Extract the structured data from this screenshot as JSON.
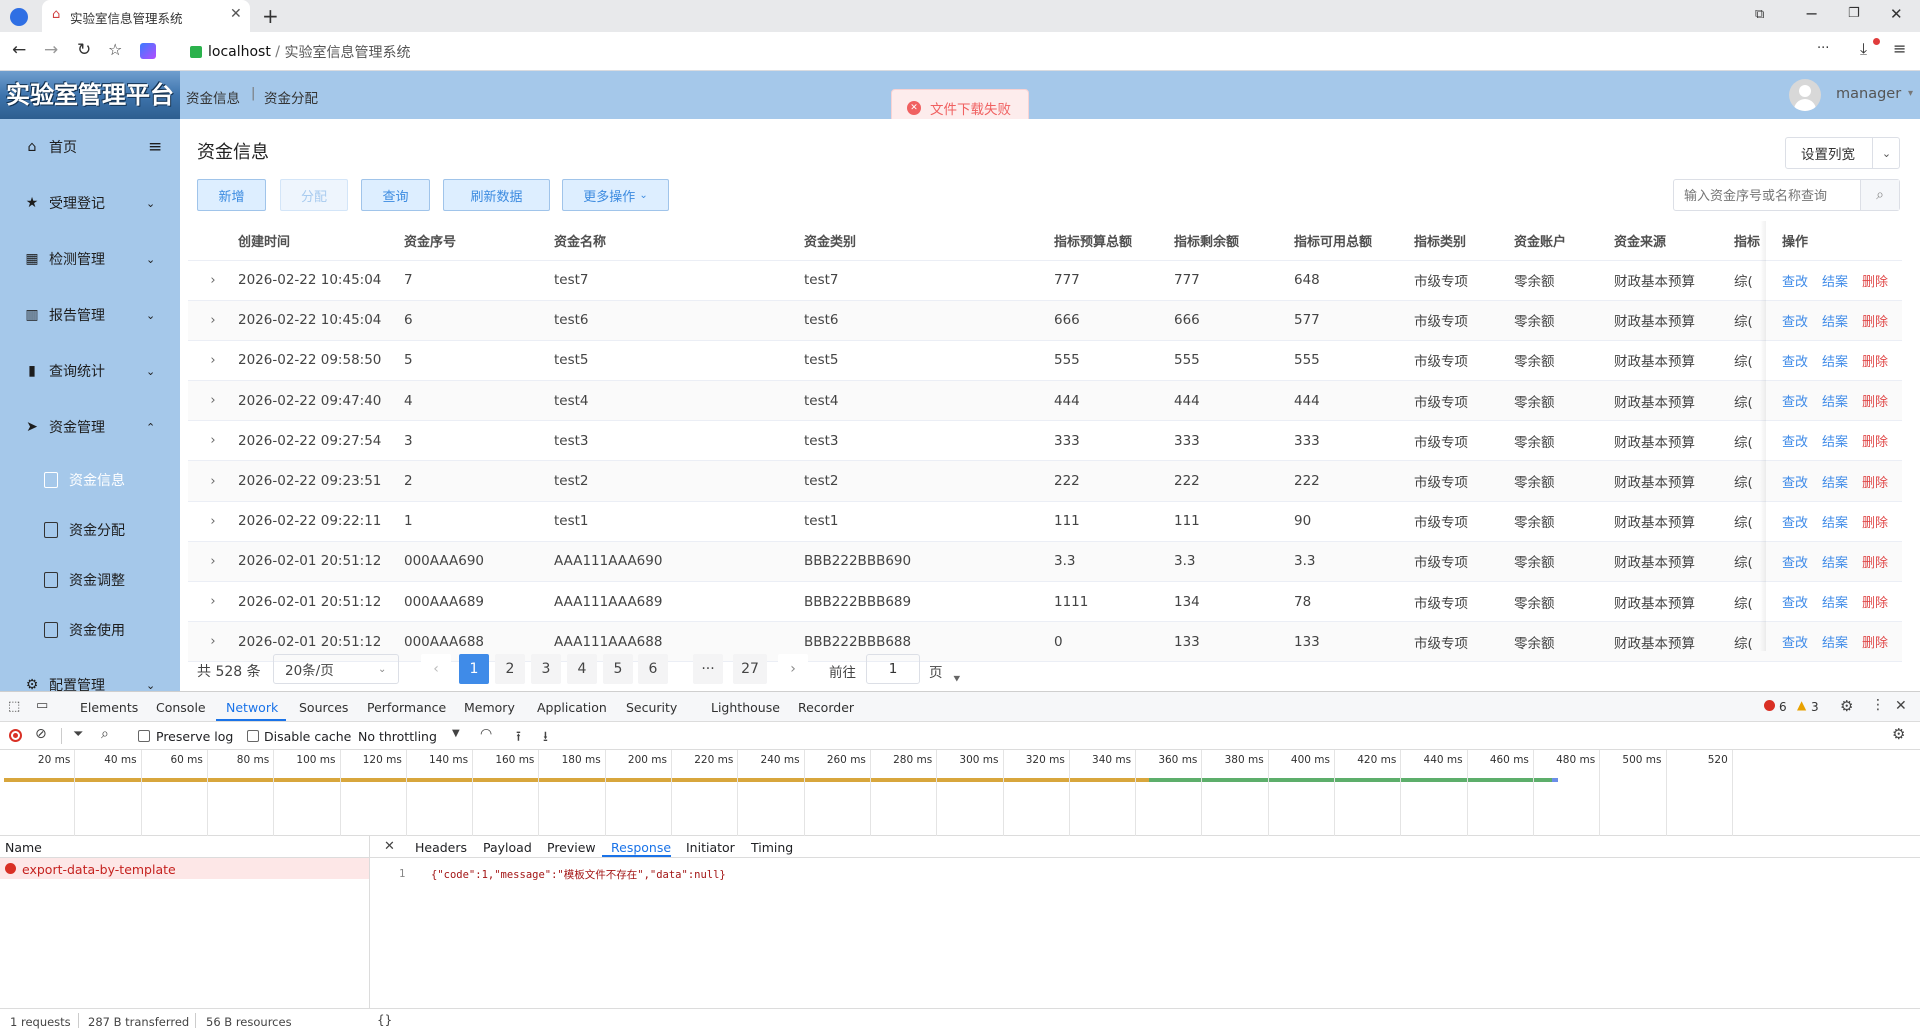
{
  "browser": {
    "tab_title": "实验室信息管理系统",
    "url_host": "localhost",
    "url_sep": " / ",
    "url_title": "实验室信息管理系统",
    "more": "···"
  },
  "header": {
    "logo": "实验室管理平台",
    "breadcrumb1": "资金信息",
    "breadcrumb_sep": "|",
    "breadcrumb2": "资金分配",
    "user": "manager",
    "toast": "文件下载失败"
  },
  "sidebar": {
    "items": [
      {
        "label": "首页"
      },
      {
        "label": "受理登记"
      },
      {
        "label": "检测管理"
      },
      {
        "label": "报告管理"
      },
      {
        "label": "查询统计"
      },
      {
        "label": "资金管理"
      },
      {
        "label": "配置管理"
      }
    ],
    "sub_items": [
      {
        "label": "资金信息"
      },
      {
        "label": "资金分配"
      },
      {
        "label": "资金调整"
      },
      {
        "label": "资金使用"
      }
    ]
  },
  "page": {
    "title": "资金信息",
    "set_width": "设置列宽",
    "buttons": {
      "add": "新增",
      "assign": "分配",
      "query": "查询",
      "refresh": "刷新数据",
      "more": "更多操作"
    },
    "search_placeholder": "输入资金序号或名称查询"
  },
  "table": {
    "headers": [
      "创建时间",
      "资金序号",
      "资金名称",
      "资金类别",
      "指标预算总额",
      "指标剩余额",
      "指标可用总额",
      "指标类别",
      "资金账户",
      "资金来源",
      "指标",
      "操作"
    ],
    "ops": {
      "edit": "查改",
      "close": "结案",
      "delete": "删除"
    },
    "rows": [
      [
        "2026-02-22 10:45:04",
        "7",
        "test7",
        "test7",
        "777",
        "777",
        "648",
        "市级专项",
        "零余额",
        "财政基本预算",
        "综("
      ],
      [
        "2026-02-22 10:45:04",
        "6",
        "test6",
        "test6",
        "666",
        "666",
        "577",
        "市级专项",
        "零余额",
        "财政基本预算",
        "综("
      ],
      [
        "2026-02-22 09:58:50",
        "5",
        "test5",
        "test5",
        "555",
        "555",
        "555",
        "市级专项",
        "零余额",
        "财政基本预算",
        "综("
      ],
      [
        "2026-02-22 09:47:40",
        "4",
        "test4",
        "test4",
        "444",
        "444",
        "444",
        "市级专项",
        "零余额",
        "财政基本预算",
        "综("
      ],
      [
        "2026-02-22 09:27:54",
        "3",
        "test3",
        "test3",
        "333",
        "333",
        "333",
        "市级专项",
        "零余额",
        "财政基本预算",
        "综("
      ],
      [
        "2026-02-22 09:23:51",
        "2",
        "test2",
        "test2",
        "222",
        "222",
        "222",
        "市级专项",
        "零余额",
        "财政基本预算",
        "综("
      ],
      [
        "2026-02-22 09:22:11",
        "1",
        "test1",
        "test1",
        "111",
        "111",
        "90",
        "市级专项",
        "零余额",
        "财政基本预算",
        "综("
      ],
      [
        "2026-02-01 20:51:12",
        "000AAA690",
        "AAA111AAA690",
        "BBB222BBB690",
        "3.3",
        "3.3",
        "3.3",
        "市级专项",
        "零余额",
        "财政基本预算",
        "综("
      ],
      [
        "2026-02-01 20:51:12",
        "000AAA689",
        "AAA111AAA689",
        "BBB222BBB689",
        "1111",
        "134",
        "78",
        "市级专项",
        "零余额",
        "财政基本预算",
        "综("
      ],
      [
        "2026-02-01 20:51:12",
        "000AAA688",
        "AAA111AAA688",
        "BBB222BBB688",
        "0",
        "133",
        "133",
        "市级专项",
        "零余额",
        "财政基本预算",
        "综("
      ]
    ]
  },
  "pagination": {
    "total": "共 528 条",
    "page_size": "20条/页",
    "pages": [
      "1",
      "2",
      "3",
      "4",
      "5",
      "6"
    ],
    "ellipsis": "···",
    "last": "27",
    "goto_label": "前往",
    "goto_value": "1",
    "goto_unit": "页"
  },
  "devtools": {
    "tabs": [
      "Elements",
      "Console",
      "Network",
      "Sources",
      "Performance",
      "Memory",
      "Application",
      "Security",
      "Lighthouse",
      "Recorder"
    ],
    "errors": "6",
    "warnings": "3",
    "preserve_log": "Preserve log",
    "disable_cache": "Disable cache",
    "throttling": "No throttling",
    "ticks": [
      "20 ms",
      "40 ms",
      "60 ms",
      "80 ms",
      "100 ms",
      "120 ms",
      "140 ms",
      "160 ms",
      "180 ms",
      "200 ms",
      "220 ms",
      "240 ms",
      "260 ms",
      "280 ms",
      "300 ms",
      "320 ms",
      "340 ms",
      "360 ms",
      "380 ms",
      "400 ms",
      "420 ms",
      "440 ms",
      "460 ms",
      "480 ms",
      "500 ms",
      "520"
    ],
    "name_header": "Name",
    "request": "export-data-by-template",
    "detail_tabs": [
      "Headers",
      "Payload",
      "Preview",
      "Response",
      "Initiator",
      "Timing"
    ],
    "response_line": "1",
    "response_text": "{\"code\":1,\"message\":\"模板文件不存在\",\"data\":null}",
    "status": {
      "requests": "1 requests",
      "transferred": "287 B transferred",
      "resources": "56 B resources"
    },
    "braces": "{}"
  },
  "colors": {
    "accent": "#3f8be8",
    "sidebar": "#a5c8ea",
    "danger": "#e04848",
    "toast_bg": "#fdecec"
  }
}
